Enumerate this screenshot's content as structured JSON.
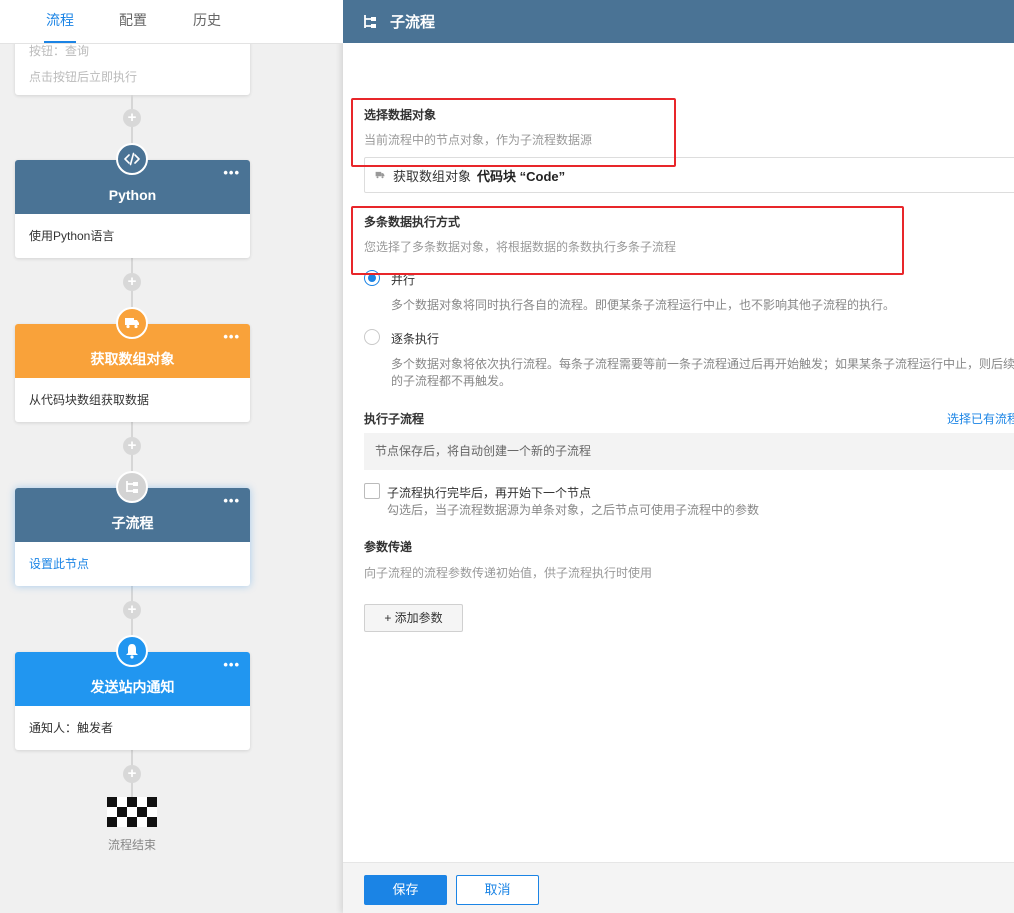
{
  "tabs": [
    "流程",
    "配置",
    "历史"
  ],
  "prev_node": {
    "line1": "按钮：查询",
    "line2": "点击按钮后立即执行"
  },
  "nodes": [
    {
      "title": "Python",
      "body": "使用Python语言",
      "color": "#4a7395",
      "icon": "code-icon",
      "more": "•••"
    },
    {
      "title": "获取数组对象",
      "body": "从代码块数组获取数据",
      "color": "#f9a23a",
      "icon": "truck-icon",
      "more": "•••"
    },
    {
      "title": "子流程",
      "body": "设置此节点",
      "color": "#4a7395",
      "icon": "subflow-icon",
      "more": "•••"
    },
    {
      "title": "发送站内通知",
      "body": "通知人：触发者",
      "color": "#2196f0",
      "icon": "bell-icon",
      "more": "•••"
    }
  ],
  "flow_end_label": "流程结束",
  "plus_symbol": "+",
  "drawer": {
    "title": "子流程",
    "data_source_section": "选择数据对象",
    "data_source_hint": "当前流程中的节点对象，作为子流程数据源",
    "data_source_value": "获取数组对象",
    "data_source_value_bold": "代码块 “Code”",
    "exec_mode_section": "多条数据执行方式",
    "exec_mode_hint": "您选择了多条数据对象，将根据数据的条数执行多条子流程",
    "exec_mode_options": [
      {
        "label": "并行",
        "desc": "多个数据对象将同时执行各自的流程。即便某条子流程运行中止，也不影响其他子流程的执行。",
        "selected": true
      },
      {
        "label": "逐条执行",
        "desc": "多个数据对象将依次执行流程。每条子流程需要等前一条子流程通过后再开始触发；如果某条子流程运行中止，则后续的子流程都不再触发。",
        "selected": false
      }
    ],
    "run_subflow_section": "执行子流程",
    "select_existing_link": "选择已有流程",
    "run_subflow_info": "节点保存后，将自动创建一个新的子流程",
    "wait_checkbox_label": "子流程执行完毕后，再开始下一个节点",
    "wait_checkbox_hint": "勾选后，当子流程数据源为单条对象，之后节点可使用子流程中的参数",
    "wait_checkbox_checked": false,
    "params_section": "参数传递",
    "params_hint": "向子流程的流程参数传递初始值，供子流程执行时使用",
    "add_param_button": "+ 添加参数",
    "save_button": "保存",
    "cancel_button": "取消"
  },
  "colors": {
    "accent": "#1b84e5",
    "header": "#4a7395",
    "orange": "#f9a23a",
    "notify": "#2196f0",
    "annotation_red": "#e8262a"
  }
}
